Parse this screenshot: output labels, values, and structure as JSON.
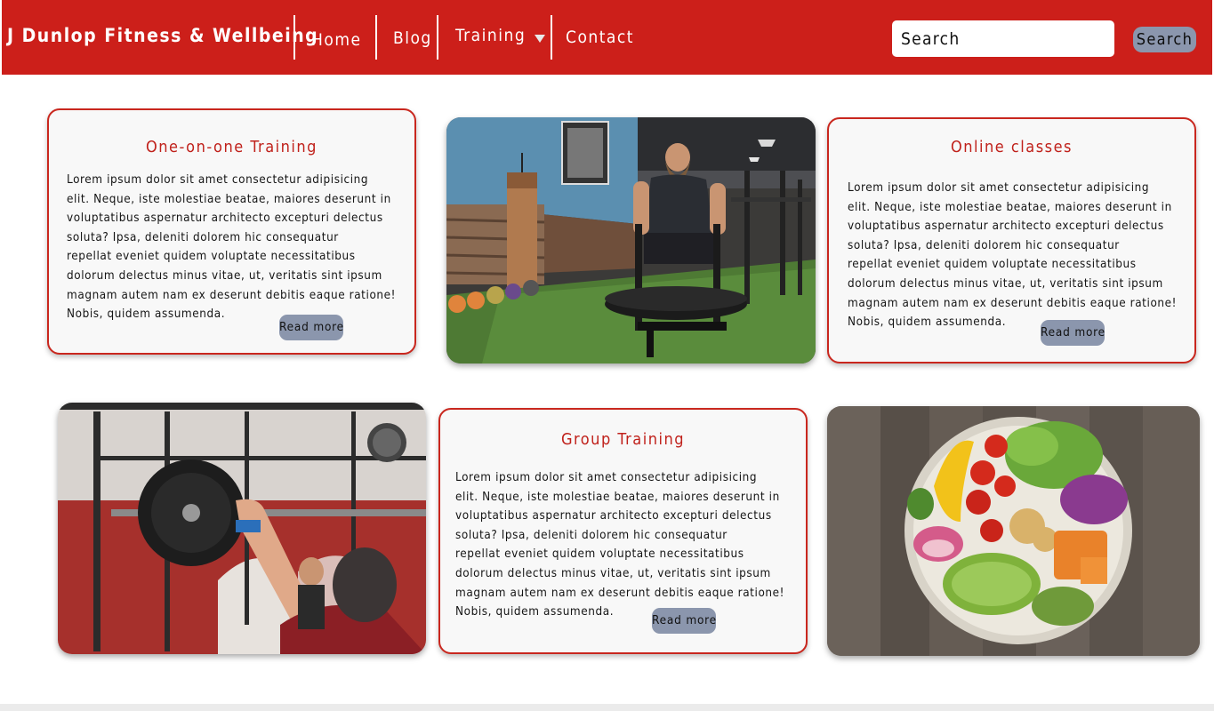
{
  "brand": "J Dunlop Fitness & Wellbeing",
  "nav": {
    "home": "Home",
    "blog": "Blog",
    "training": "Training",
    "contact": "Contact"
  },
  "search": {
    "placeholder": "Search",
    "button_label": "Search"
  },
  "body_text_lines": [
    "Lorem ipsum dolor sit amet consectetur adipisicing",
    "elit. Neque, iste molestiae beatae, maiores deserunt in",
    "voluptatibus aspernatur architecto excepturi delectus",
    "soluta? Ipsa, deleniti dolorem hic consequatur",
    "repellat eveniet quidem voluptate necessitatibus",
    "dolorum delectus minus vitae, ut, veritatis sint ipsum",
    "magnam autem nam ex deserunt debitis eaque ratione!",
    "Nobis, quidem assumenda."
  ],
  "cards": {
    "one_on_one": {
      "title": "One-on-one Training",
      "read_more": "Read more"
    },
    "online": {
      "title": "Online classes",
      "read_more": "Read more"
    },
    "group": {
      "title": "Group Training",
      "read_more": "Read more"
    }
  },
  "colors": {
    "brand_red": "#cc1f1a",
    "button_slate": "#8b96ad",
    "card_background": "#f8f8f8"
  },
  "icons": {
    "training_dropdown": "chevron-down-icon"
  }
}
